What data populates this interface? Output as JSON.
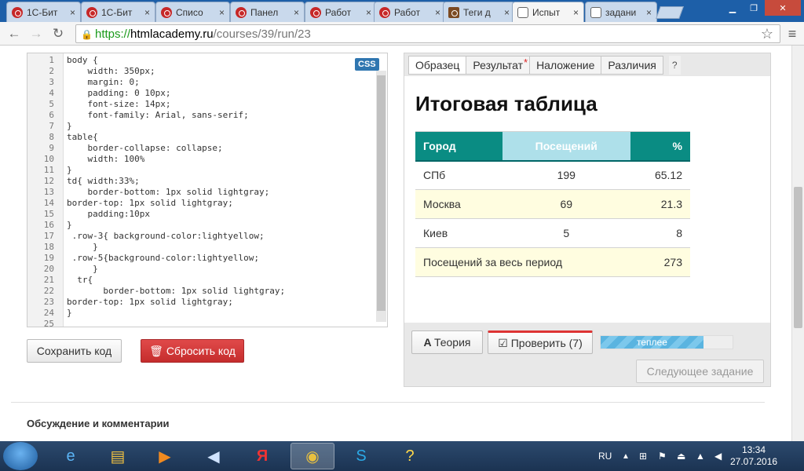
{
  "browser": {
    "tabs": [
      {
        "label": "1С-Бит",
        "icon": "bitrix-icon"
      },
      {
        "label": "1С-Бит",
        "icon": "bitrix-icon"
      },
      {
        "label": "Списо",
        "icon": "bitrix-icon"
      },
      {
        "label": "Панел",
        "icon": "bitrix-icon"
      },
      {
        "label": "Работ",
        "icon": "bitrix-icon"
      },
      {
        "label": "Работ",
        "icon": "bitrix-icon"
      },
      {
        "label": "Теги д",
        "icon": "htmlbook-icon"
      },
      {
        "label": "Испыт",
        "icon": "shield-icon",
        "active": true
      },
      {
        "label": "задани",
        "icon": "shield-icon"
      }
    ],
    "url": {
      "proto": "https://",
      "host": "htmlacademy.ru",
      "path": "/courses/39/run/23"
    }
  },
  "editor": {
    "badge": "CSS",
    "lines": [
      "body {",
      "    width: 350px;",
      "    margin: 0;",
      "    padding: 0 10px;",
      "    font-size: 14px;",
      "    font-family: Arial, sans-serif;",
      "}",
      "table{",
      "    border-collapse: collapse;",
      "    width: 100%",
      "}",
      "td{ width:33%;",
      "    border-bottom: 1px solid lightgray;",
      "border-top: 1px solid lightgray;",
      "    padding:10px",
      "}",
      " .row-3{ background-color:lightyellow;",
      "     }",
      " .row-5{background-color:lightyellow;",
      "     }",
      "  tr{",
      "       border-bottom: 1px solid lightgray;",
      "border-top: 1px solid lightgray;",
      "}",
      ""
    ],
    "save_label": "Сохранить код",
    "reset_label": "Сбросить код"
  },
  "preview": {
    "tabs": [
      "Образец",
      "Результат",
      "Наложение",
      "Различия"
    ],
    "help": "?",
    "title": "Итоговая таблица",
    "table": {
      "header": [
        "Город",
        "Посещений",
        "%"
      ],
      "rows": [
        [
          "СПб",
          "199",
          "65.12"
        ],
        [
          "Москва",
          "69",
          "21.3"
        ],
        [
          "Киев",
          "5",
          "8"
        ],
        [
          "Посещений за весь период",
          "",
          "273"
        ]
      ]
    },
    "theory_label": "Теория",
    "check_label": "Проверить (7)",
    "progress_label": "теплее",
    "progress_value": 0.78,
    "next_label": "Следующее задание"
  },
  "discussion": "Обсуждение и комментарии",
  "taskbar": {
    "lang": "RU",
    "time": "13:34",
    "date": "27.07.2016"
  },
  "colors": {
    "accent": "#0a8c83",
    "reset": "#c52c2c",
    "link_green": "#1b9a1b"
  }
}
